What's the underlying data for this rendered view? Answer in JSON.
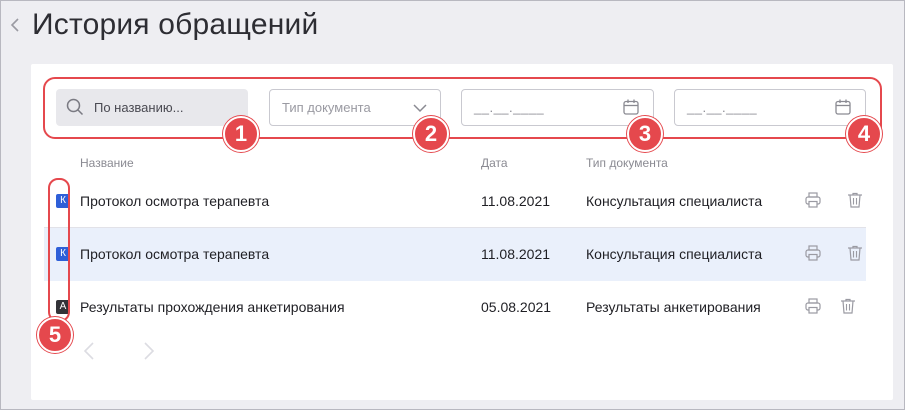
{
  "header": {
    "back_icon": "chevron-left-icon",
    "title": "История обращений"
  },
  "filters": {
    "search_placeholder": "По названию...",
    "search_icon": "search-icon",
    "doc_type_placeholder": "Тип документа",
    "doc_type_icon": "chevron-down-icon",
    "date_from_placeholder": "__.__.____",
    "date_to_placeholder": "__.__.____",
    "calendar_icon": "calendar-icon"
  },
  "annotations": [
    "1",
    "2",
    "3",
    "4",
    "5"
  ],
  "table": {
    "columns": [
      "Название",
      "Дата",
      "Тип документа"
    ],
    "rows": [
      {
        "tag": "К",
        "tag_color": "#2e5fd8",
        "name": "Протокол осмотра терапевта",
        "date": "11.08.2021",
        "type": "Консультация специалиста",
        "selected": false
      },
      {
        "tag": "К",
        "tag_color": "#2e5fd8",
        "name": "Протокол осмотра терапевта",
        "date": "11.08.2021",
        "type": "Консультация специалиста",
        "selected": true
      },
      {
        "tag": "А",
        "tag_color": "#333338",
        "name": "Результаты прохождения анкетирования",
        "date": "05.08.2021",
        "type": "Результаты анкетирования",
        "selected": false
      }
    ],
    "row_actions": [
      "printer-icon",
      "trash-icon"
    ]
  },
  "pagination": {
    "prev_icon": "chevron-left-icon",
    "next_icon": "chevron-right-icon"
  },
  "colors": {
    "accent_red": "#e5484d",
    "tag_blue": "#2e5fd8",
    "tag_dark": "#333338",
    "selected_row": "#eaf0fb"
  }
}
